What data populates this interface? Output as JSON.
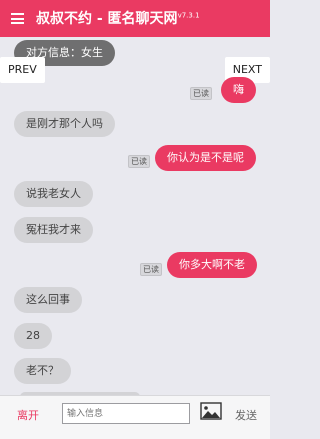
{
  "header": {
    "title": "叔叔不约 - 匿名聊天网",
    "version": "v7.3.1",
    "menu_icon": "hamburger-menu-icon"
  },
  "nav": {
    "prev_label": "PREV",
    "next_label": "NEXT"
  },
  "chat": {
    "system_info": "对方信息：女生",
    "read_label": "已读",
    "messages": [
      {
        "from": "me",
        "text": "嗨"
      },
      {
        "from": "them",
        "text": "是刚才那个人吗"
      },
      {
        "from": "me",
        "text": "你认为是不是呢"
      },
      {
        "from": "them",
        "text": "说我老女人"
      },
      {
        "from": "them",
        "text": "冤枉我才来"
      },
      {
        "from": "me",
        "text": "你多大啊不老"
      },
      {
        "from": "them",
        "text": "这么回事"
      },
      {
        "from": "them",
        "text": "28"
      },
      {
        "from": "them",
        "text": "老不？"
      }
    ]
  },
  "footer": {
    "leave_label": "离开",
    "input_placeholder": "输入信息",
    "image_icon": "image-icon",
    "send_label": "发送"
  },
  "colors": {
    "accent": "#ea3a62",
    "background": "#e9e9ef",
    "bubble_them": "#d3d3d6"
  }
}
